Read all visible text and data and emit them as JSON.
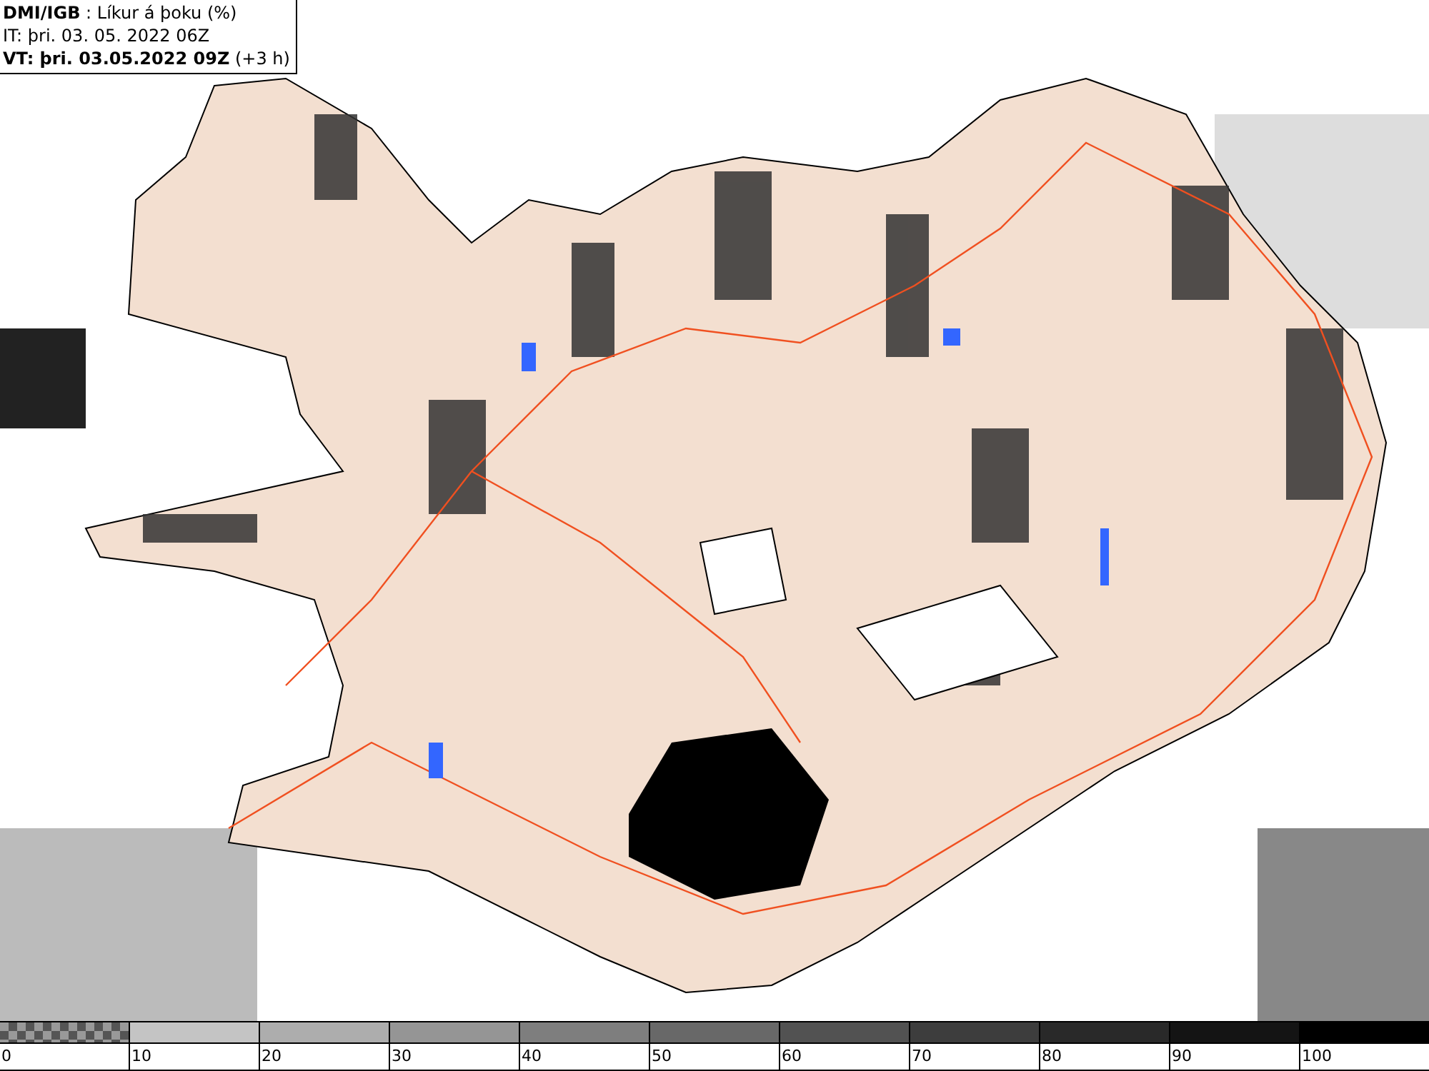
{
  "header": {
    "lines": [
      "**DMI/IGB** : Líkur á þoku (%)",
      "IT: þri. 03. 05. 2022 06Z",
      "**VT: þri. 03.05.2022 09Z** (+3 h)"
    ]
  },
  "legend": {
    "segments": [
      {
        "kind": "checkered",
        "label": "0"
      },
      {
        "kind": "solid",
        "color": "#c4c4c4",
        "label": "10"
      },
      {
        "kind": "solid",
        "color": "#adadad",
        "label": "20"
      },
      {
        "kind": "solid",
        "color": "#959595",
        "label": "30"
      },
      {
        "kind": "solid",
        "color": "#7e7e7e",
        "label": "40"
      },
      {
        "kind": "solid",
        "color": "#686868",
        "label": "50"
      },
      {
        "kind": "solid",
        "color": "#525252",
        "label": "60"
      },
      {
        "kind": "solid",
        "color": "#3d3d3d",
        "label": "70"
      },
      {
        "kind": "solid",
        "color": "#292929",
        "label": "80"
      },
      {
        "kind": "solid",
        "color": "#141414",
        "label": "90"
      },
      {
        "kind": "solid",
        "color": "#000000",
        "label": "100"
      }
    ]
  }
}
